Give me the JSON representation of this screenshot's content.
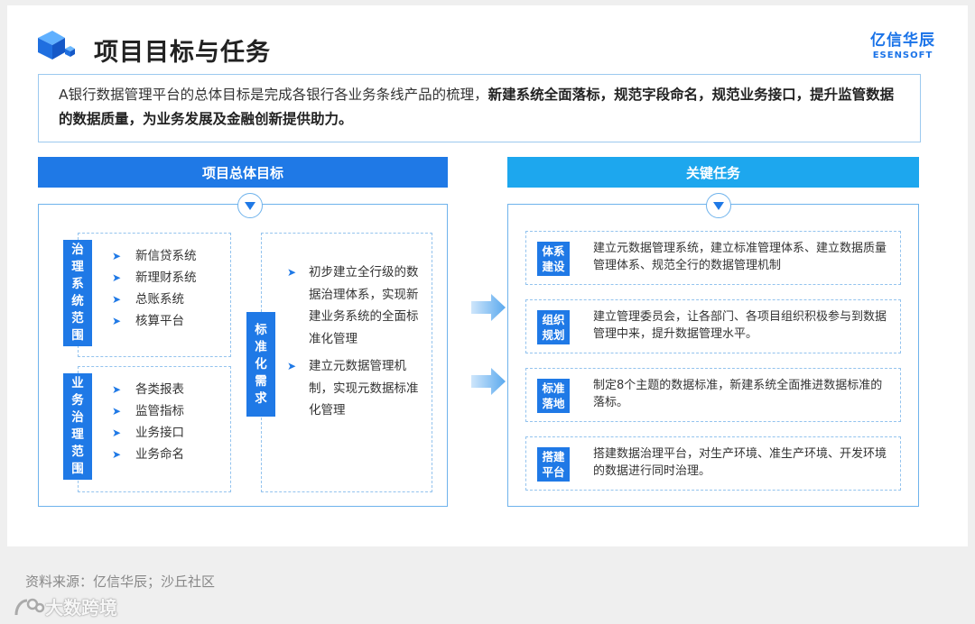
{
  "header": {
    "title": "项目目标与任务",
    "logo_cn": "亿信华辰",
    "logo_en": "ESENSOFT"
  },
  "intro": {
    "prefix": "A银行数据管理平台的总体目标是完成各银行各业务条线产品的梳理，",
    "bold": "新建系统全面落标，规范字段命名，规范业务接口，提升监管数据的数据质量，为业务发展及金融创新提供助力。"
  },
  "left_panel": {
    "title": "项目总体目标",
    "governance_scope": {
      "label": "治理系统范围",
      "items": [
        "新信贷系统",
        "新理财系统",
        "总账系统",
        "核算平台"
      ]
    },
    "business_scope": {
      "label": "业务治理范围",
      "items": [
        "各类报表",
        "监管指标",
        "业务接口",
        "业务命名"
      ]
    },
    "standardization": {
      "label": "标准化需求",
      "items": [
        "初步建立全行级的数据治理体系，实现新建业务系统的全面标准化管理",
        "建立元数据管理机制，实现元数据标准化管理"
      ]
    }
  },
  "right_panel": {
    "title": "关键任务",
    "tasks": [
      {
        "badge": [
          "体系",
          "建设"
        ],
        "text": "建立元数据管理系统，建立标准管理体系、建立数据质量管理体系、规范全行的数据管理机制"
      },
      {
        "badge": [
          "组织",
          "规划"
        ],
        "text": "建立管理委员会，让各部门、各项目组织积极参与到数据管理中来，提升数据管理水平。"
      },
      {
        "badge": [
          "标准",
          "落地"
        ],
        "text": "制定8个主题的数据标准，新建系统全面推进数据标准的落标。"
      },
      {
        "badge": [
          "搭建",
          "平台"
        ],
        "text": "搭建数据治理平台，对生产环境、准生产环境、开发环境的数据进行同时治理。"
      }
    ]
  },
  "footer": {
    "source": "资料来源：亿信华辰；沙丘社区",
    "watermark": "大数跨境"
  },
  "colors": {
    "primary_blue": "#1f79e6",
    "light_blue": "#1da7ee",
    "border_blue": "#6fb3ec"
  },
  "icons": [
    "cube-logo-icon",
    "chevron-down-icon",
    "chevron-right-icon",
    "arrow-right-icon"
  ]
}
